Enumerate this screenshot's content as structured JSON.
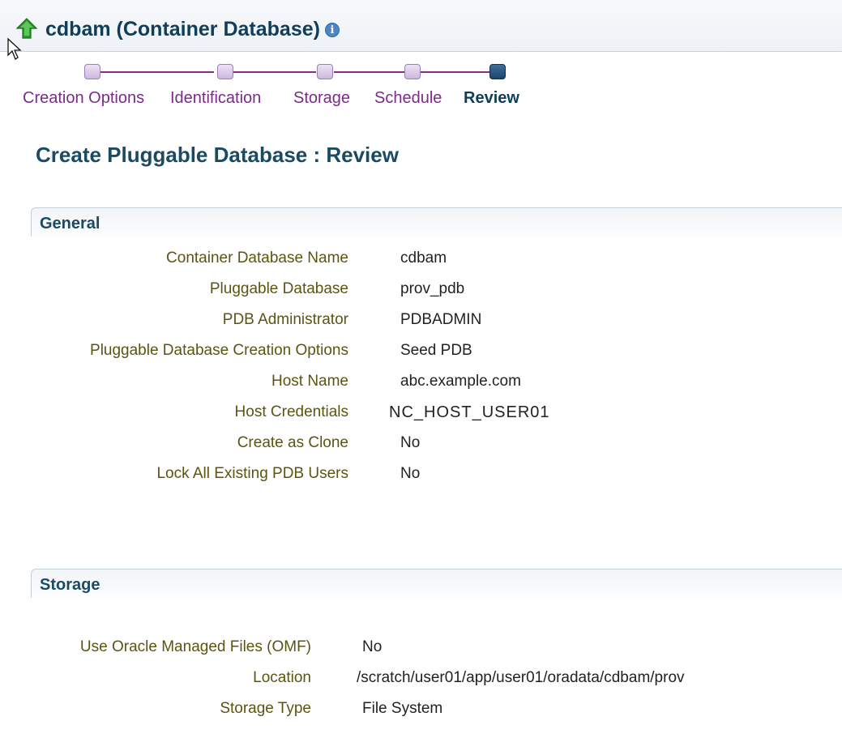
{
  "header": {
    "title": "cdbam (Container Database)"
  },
  "train": {
    "steps": [
      {
        "label": "Creation Options"
      },
      {
        "label": "Identification"
      },
      {
        "label": "Storage"
      },
      {
        "label": "Schedule"
      },
      {
        "label": "Review"
      }
    ],
    "current": "Review"
  },
  "page_title": "Create Pluggable Database : Review",
  "general": {
    "title": "General",
    "fields": [
      {
        "label": "Container Database Name",
        "value": "cdbam"
      },
      {
        "label": "Pluggable Database",
        "value": "prov_pdb"
      },
      {
        "label": "PDB Administrator",
        "value": "PDBADMIN"
      },
      {
        "label": "Pluggable Database Creation Options",
        "value": "Seed PDB"
      },
      {
        "label": "Host Name",
        "value": "abc.example.com"
      },
      {
        "label": "Host Credentials",
        "value": "NC_HOST_USER01"
      },
      {
        "label": "Create as Clone",
        "value": "No"
      },
      {
        "label": "Lock All Existing PDB Users",
        "value": "No"
      }
    ]
  },
  "storage": {
    "title": "Storage",
    "fields": [
      {
        "label": "Use Oracle Managed Files (OMF)",
        "value": "No"
      },
      {
        "label": "Location",
        "value": "/scratch/user01/app/user01/oradata/cdbam/prov"
      },
      {
        "label": "Storage Type",
        "value": "File System"
      }
    ]
  },
  "colors": {
    "train_link": "#7c2a8a",
    "train_current": "#0f3d5a",
    "label": "#5c5412",
    "heading": "#1b4a63"
  },
  "icons": [
    "up-arrow-icon",
    "info-icon",
    "cursor-icon"
  ]
}
